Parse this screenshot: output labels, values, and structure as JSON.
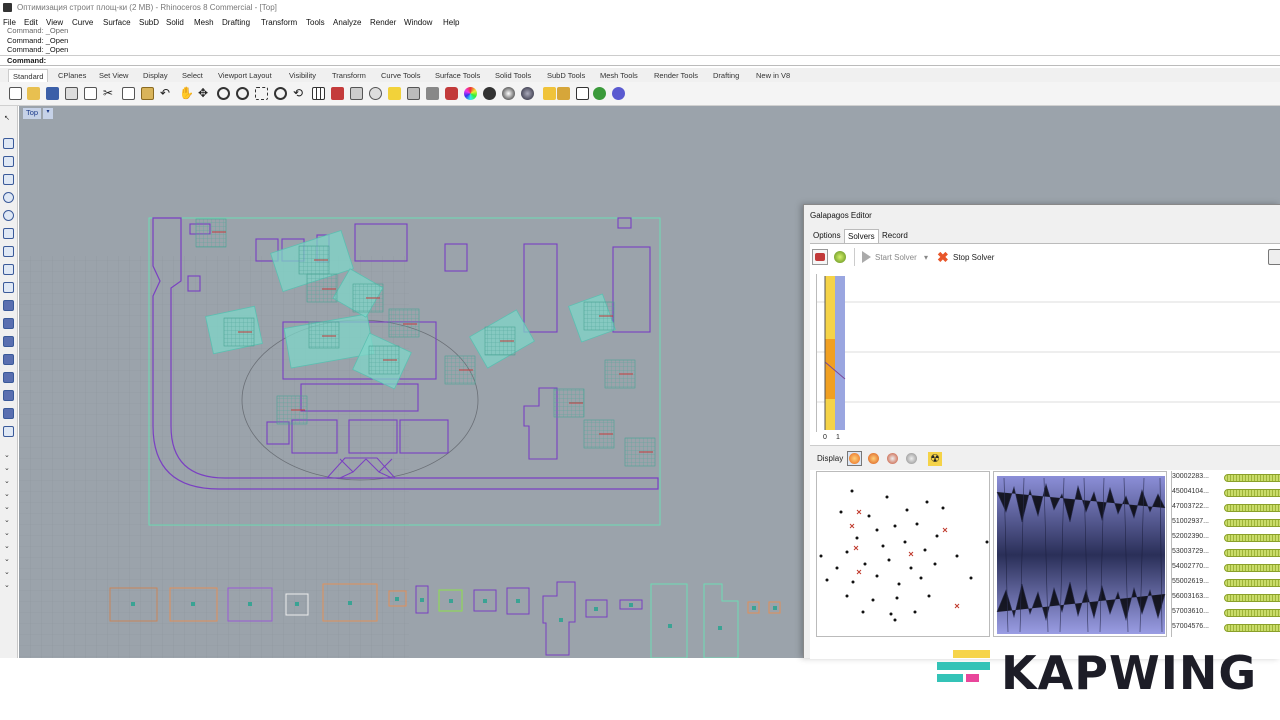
{
  "window": {
    "title": "Оптимизация строит площ-ки (2 MB) - Rhinoceros 8 Commercial - [Top]"
  },
  "menu": [
    "File",
    "Edit",
    "View",
    "Curve",
    "Surface",
    "SubD",
    "Solid",
    "Mesh",
    "Drafting",
    "Transform",
    "Tools",
    "Analyze",
    "Render",
    "Window",
    "Help"
  ],
  "command_history": [
    "Command: _Open",
    "Command: _Open",
    "Command: _Open"
  ],
  "command_prompt": "Command:",
  "toolbar_tabs": [
    "Standard",
    "CPlanes",
    "Set View",
    "Display",
    "Select",
    "Viewport Layout",
    "Visibility",
    "Transform",
    "Curve Tools",
    "Surface Tools",
    "Solid Tools",
    "SubD Tools",
    "Mesh Tools",
    "Render Tools",
    "Drafting",
    "New in V8"
  ],
  "viewport": {
    "name": "Top",
    "menu_arrow": "▾"
  },
  "galapagos": {
    "title": "Galapagos Editor",
    "tabs": [
      "Options",
      "Solvers",
      "Record"
    ],
    "active_tab": "Solvers",
    "start_solver": "Start Solver",
    "stop_solver": "Stop Solver",
    "axis_labels": [
      "0",
      "1"
    ],
    "display_label": "Display",
    "fitness_values": [
      "30002283...",
      "45004104...",
      "47003722...",
      "51002937...",
      "52002390...",
      "53003729...",
      "54002770...",
      "55002619...",
      "56003163...",
      "57003610...",
      "57004576..."
    ]
  },
  "watermark": {
    "brand": "KAPWING",
    "colors": {
      "teal": "#34c3b7",
      "yellow": "#f6d44a",
      "pink": "#e9469b",
      "text": "#1d1d27"
    }
  },
  "colors": {
    "viewport_bg": "#9ba3ab",
    "building_outline": "#7a3fc2",
    "site_boundary": "#6cdcb4",
    "selected_fill": "#7fd6c8"
  }
}
